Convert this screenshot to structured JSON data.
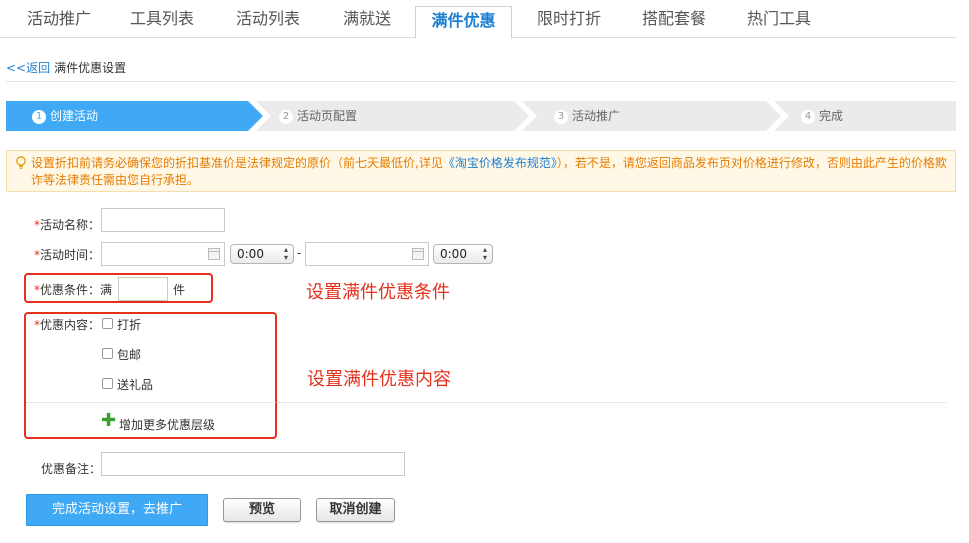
{
  "tabs": [
    {
      "label": "活动推广",
      "active": false
    },
    {
      "label": "工具列表",
      "active": false
    },
    {
      "label": "活动列表",
      "active": false
    },
    {
      "label": "满就送",
      "active": false
    },
    {
      "label": "满件优惠",
      "active": true
    },
    {
      "label": "限时打折",
      "active": false
    },
    {
      "label": "搭配套餐",
      "active": false
    },
    {
      "label": "热门工具",
      "active": false
    }
  ],
  "breadcrumb": {
    "back_label": "<<返回",
    "title": "满件优惠设置"
  },
  "steps": [
    {
      "number": "1",
      "label": "创建活动",
      "active": true
    },
    {
      "number": "2",
      "label": "活动页配置",
      "active": false
    },
    {
      "number": "3",
      "label": "活动推广",
      "active": false
    },
    {
      "number": "4",
      "label": "完成",
      "active": false
    }
  ],
  "notice": {
    "text_before": "设置折扣前请务必确保您的折扣基准价是法律规定的原价（前七天最低价,详见",
    "link": "《淘宝价格发布规范》",
    "text_after": "），若不是，请您返回商品发布页对价格进行修改，否则由此产生的价格欺诈等法律责任需由您自行承担。"
  },
  "form": {
    "required_mark": "*",
    "name_label": "活动名称：",
    "time_label": "活动时间：",
    "start_time": "0:00",
    "time_separator": "-",
    "end_time": "0:00",
    "condition_label": "优惠条件：",
    "condition_prefix": "满",
    "condition_suffix": "件",
    "content_label": "优惠内容：",
    "options": [
      "打折",
      "包邮",
      "送礼品"
    ],
    "add_tier_label": "增加更多优惠层级",
    "remark_label": "优惠备注："
  },
  "annotations": {
    "condition": "设置满件优惠条件",
    "content": "设置满件优惠内容"
  },
  "buttons": {
    "submit": "完成活动设置，去推广",
    "preview": "预览",
    "cancel": "取消创建"
  },
  "colors": {
    "accent": "#3fa9f5",
    "link": "#1e7fd0",
    "annotation_red": "#e5301c",
    "notice_bg": "#fff8e6",
    "notice_text": "#e67c00",
    "step_inactive": "#ebebeb"
  },
  "icons": {
    "notice": "lightbulb-icon",
    "calendar": "calendar-icon",
    "add": "plus-icon"
  }
}
